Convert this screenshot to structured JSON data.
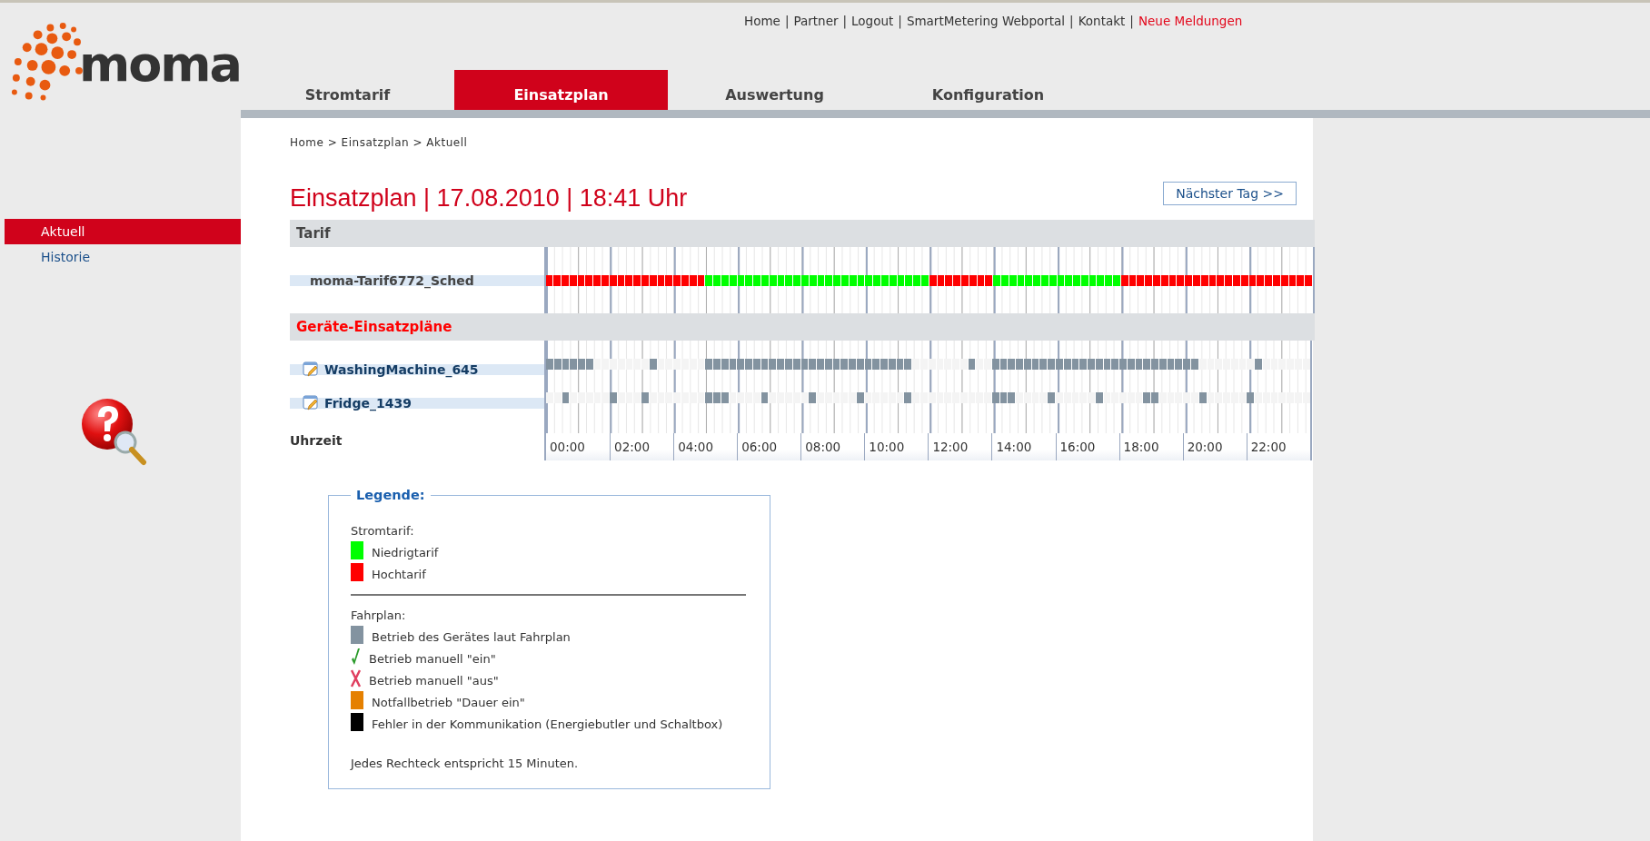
{
  "top_links": {
    "separator": "|",
    "items": [
      {
        "label": "Home",
        "kind": "normal"
      },
      {
        "label": "Partner",
        "kind": "normal"
      },
      {
        "label": "Logout",
        "kind": "normal"
      },
      {
        "label": "SmartMetering Webportal",
        "kind": "normal"
      },
      {
        "label": "Kontakt",
        "kind": "normal"
      },
      {
        "label": "Neue Meldungen",
        "kind": "alert"
      }
    ]
  },
  "logo": {
    "text": "moma"
  },
  "tabs": [
    {
      "label": "Stromtarif",
      "selected": false
    },
    {
      "label": "Einsatzplan",
      "selected": true
    },
    {
      "label": "Auswertung",
      "selected": false
    },
    {
      "label": "Konfiguration",
      "selected": false
    }
  ],
  "sidebar": {
    "items": [
      {
        "label": "Aktuell",
        "selected": true
      },
      {
        "label": "Historie",
        "selected": false
      }
    ]
  },
  "breadcrumb": "Home > Einsatzplan > Aktuell",
  "title": "Einsatzplan | 17.08.2010 | 18:41 Uhr",
  "next_day_button": "Nächster Tag >>",
  "tariff": {
    "heading": "Tarif",
    "name": "moma-Tarif6772_Sched",
    "slots": [
      {
        "low": false
      },
      {
        "low": false
      },
      {
        "low": false
      },
      {
        "low": false
      },
      {
        "low": false
      },
      {
        "low": false
      },
      {
        "low": false
      },
      {
        "low": false
      },
      {
        "low": false
      },
      {
        "low": false
      },
      {
        "low": false
      },
      {
        "low": false
      },
      {
        "low": false
      },
      {
        "low": false
      },
      {
        "low": false
      },
      {
        "low": false
      },
      {
        "low": false
      },
      {
        "low": false
      },
      {
        "low": false
      },
      {
        "low": false
      },
      {
        "low": true
      },
      {
        "low": true
      },
      {
        "low": true
      },
      {
        "low": true
      },
      {
        "low": true
      },
      {
        "low": true
      },
      {
        "low": true
      },
      {
        "low": true
      },
      {
        "low": true
      },
      {
        "low": true
      },
      {
        "low": true
      },
      {
        "low": true
      },
      {
        "low": true
      },
      {
        "low": true
      },
      {
        "low": true
      },
      {
        "low": true
      },
      {
        "low": true
      },
      {
        "low": true
      },
      {
        "low": true
      },
      {
        "low": true
      },
      {
        "low": true
      },
      {
        "low": true
      },
      {
        "low": true
      },
      {
        "low": true
      },
      {
        "low": true
      },
      {
        "low": true
      },
      {
        "low": true
      },
      {
        "low": true
      },
      {
        "low": false
      },
      {
        "low": false
      },
      {
        "low": false
      },
      {
        "low": false
      },
      {
        "low": false
      },
      {
        "low": false
      },
      {
        "low": false
      },
      {
        "low": false
      },
      {
        "low": true
      },
      {
        "low": true
      },
      {
        "low": true
      },
      {
        "low": true
      },
      {
        "low": true
      },
      {
        "low": true
      },
      {
        "low": true
      },
      {
        "low": true
      },
      {
        "low": true
      },
      {
        "low": true
      },
      {
        "low": true
      },
      {
        "low": true
      },
      {
        "low": true
      },
      {
        "low": true
      },
      {
        "low": true
      },
      {
        "low": true
      },
      {
        "low": false
      },
      {
        "low": false
      },
      {
        "low": false
      },
      {
        "low": false
      },
      {
        "low": false
      },
      {
        "low": false
      },
      {
        "low": false
      },
      {
        "low": false
      },
      {
        "low": false
      },
      {
        "low": false
      },
      {
        "low": false
      },
      {
        "low": false
      },
      {
        "low": false
      },
      {
        "low": false
      },
      {
        "low": false
      },
      {
        "low": false
      },
      {
        "low": false
      },
      {
        "low": false
      },
      {
        "low": false
      },
      {
        "low": false
      },
      {
        "low": false
      },
      {
        "low": false
      },
      {
        "low": false
      },
      {
        "low": false
      }
    ]
  },
  "devices": {
    "heading": "Geräte-Einsatzpläne",
    "rows": [
      {
        "name": "WashingMachine_645",
        "slots": [
          {
            "on": true
          },
          {
            "on": true
          },
          {
            "on": true
          },
          {
            "on": true
          },
          {
            "on": true
          },
          {
            "on": true
          },
          {
            "on": false
          },
          {
            "on": false
          },
          {
            "on": false
          },
          {
            "on": false
          },
          {
            "on": false
          },
          {
            "on": false
          },
          {
            "on": false
          },
          {
            "on": true
          },
          {
            "on": false
          },
          {
            "on": false
          },
          {
            "on": false
          },
          {
            "on": false
          },
          {
            "on": false
          },
          {
            "on": false
          },
          {
            "on": true
          },
          {
            "on": true
          },
          {
            "on": true
          },
          {
            "on": true
          },
          {
            "on": true
          },
          {
            "on": true
          },
          {
            "on": true
          },
          {
            "on": true
          },
          {
            "on": true
          },
          {
            "on": true
          },
          {
            "on": true
          },
          {
            "on": true
          },
          {
            "on": true
          },
          {
            "on": true
          },
          {
            "on": true
          },
          {
            "on": true
          },
          {
            "on": true
          },
          {
            "on": true
          },
          {
            "on": true
          },
          {
            "on": true
          },
          {
            "on": true
          },
          {
            "on": true
          },
          {
            "on": true
          },
          {
            "on": true
          },
          {
            "on": true
          },
          {
            "on": true
          },
          {
            "on": false
          },
          {
            "on": false
          },
          {
            "on": false
          },
          {
            "on": false
          },
          {
            "on": false
          },
          {
            "on": false
          },
          {
            "on": false
          },
          {
            "on": true
          },
          {
            "on": false
          },
          {
            "on": false
          },
          {
            "on": true
          },
          {
            "on": true
          },
          {
            "on": true
          },
          {
            "on": true
          },
          {
            "on": true
          },
          {
            "on": true
          },
          {
            "on": true
          },
          {
            "on": true
          },
          {
            "on": true
          },
          {
            "on": true
          },
          {
            "on": true
          },
          {
            "on": true
          },
          {
            "on": true
          },
          {
            "on": true
          },
          {
            "on": true
          },
          {
            "on": true
          },
          {
            "on": true
          },
          {
            "on": true
          },
          {
            "on": true
          },
          {
            "on": true
          },
          {
            "on": true
          },
          {
            "on": true
          },
          {
            "on": true
          },
          {
            "on": true
          },
          {
            "on": true
          },
          {
            "on": true
          },
          {
            "on": false
          },
          {
            "on": false
          },
          {
            "on": false
          },
          {
            "on": false
          },
          {
            "on": false
          },
          {
            "on": false
          },
          {
            "on": false
          },
          {
            "on": true
          },
          {
            "on": false
          },
          {
            "on": false
          },
          {
            "on": false
          },
          {
            "on": false
          },
          {
            "on": false
          },
          {
            "on": false
          }
        ]
      },
      {
        "name": "Fridge_1439",
        "slots": [
          {
            "on": false
          },
          {
            "on": false
          },
          {
            "on": true
          },
          {
            "on": false
          },
          {
            "on": false
          },
          {
            "on": false
          },
          {
            "on": false
          },
          {
            "on": false
          },
          {
            "on": true
          },
          {
            "on": false
          },
          {
            "on": false
          },
          {
            "on": false
          },
          {
            "on": true
          },
          {
            "on": false
          },
          {
            "on": false
          },
          {
            "on": false
          },
          {
            "on": false
          },
          {
            "on": false
          },
          {
            "on": false
          },
          {
            "on": false
          },
          {
            "on": true
          },
          {
            "on": true
          },
          {
            "on": true
          },
          {
            "on": false
          },
          {
            "on": false
          },
          {
            "on": false
          },
          {
            "on": false
          },
          {
            "on": true
          },
          {
            "on": false
          },
          {
            "on": false
          },
          {
            "on": false
          },
          {
            "on": false
          },
          {
            "on": false
          },
          {
            "on": true
          },
          {
            "on": false
          },
          {
            "on": false
          },
          {
            "on": false
          },
          {
            "on": false
          },
          {
            "on": false
          },
          {
            "on": true
          },
          {
            "on": false
          },
          {
            "on": false
          },
          {
            "on": false
          },
          {
            "on": false
          },
          {
            "on": false
          },
          {
            "on": true
          },
          {
            "on": false
          },
          {
            "on": false
          },
          {
            "on": false
          },
          {
            "on": false
          },
          {
            "on": false
          },
          {
            "on": false
          },
          {
            "on": false
          },
          {
            "on": false
          },
          {
            "on": false
          },
          {
            "on": false
          },
          {
            "on": true
          },
          {
            "on": true
          },
          {
            "on": true
          },
          {
            "on": false
          },
          {
            "on": false
          },
          {
            "on": false
          },
          {
            "on": false
          },
          {
            "on": true
          },
          {
            "on": false
          },
          {
            "on": false
          },
          {
            "on": false
          },
          {
            "on": false
          },
          {
            "on": false
          },
          {
            "on": true
          },
          {
            "on": false
          },
          {
            "on": false
          },
          {
            "on": false
          },
          {
            "on": false
          },
          {
            "on": false
          },
          {
            "on": true
          },
          {
            "on": true
          },
          {
            "on": false
          },
          {
            "on": false
          },
          {
            "on": false
          },
          {
            "on": false
          },
          {
            "on": false
          },
          {
            "on": true
          },
          {
            "on": false
          },
          {
            "on": false
          },
          {
            "on": false
          },
          {
            "on": false
          },
          {
            "on": false
          },
          {
            "on": true
          },
          {
            "on": false
          },
          {
            "on": false
          },
          {
            "on": false
          },
          {
            "on": false
          },
          {
            "on": false
          },
          {
            "on": false
          },
          {
            "on": false
          }
        ]
      }
    ]
  },
  "time_axis": {
    "label": "Uhrzeit",
    "ticks": [
      "00:00",
      "02:00",
      "04:00",
      "06:00",
      "08:00",
      "10:00",
      "12:00",
      "14:00",
      "16:00",
      "18:00",
      "20:00",
      "22:00"
    ]
  },
  "legend": {
    "title": "Legende:",
    "sections": [
      {
        "heading": "Stromtarif:",
        "items": [
          {
            "kind": "low",
            "label": "Niedrigtarif"
          },
          {
            "kind": "high",
            "label": "Hochtarif"
          }
        ]
      },
      {
        "heading": "Fahrplan:",
        "items": [
          {
            "kind": "scheduled",
            "label": "Betrieb des Gerätes laut Fahrplan"
          },
          {
            "kind": "manual_on",
            "label": "Betrieb manuell \"ein\""
          },
          {
            "kind": "manual_off",
            "label": "Betrieb manuell \"aus\""
          },
          {
            "kind": "emergency",
            "label": "Notfallbetrieb \"Dauer ein\""
          },
          {
            "kind": "error",
            "label": "Fehler in der Kommunikation (Energiebutler und Schaltbox)"
          }
        ]
      }
    ],
    "note": "Jedes Rechteck entspricht 15 Minuten."
  }
}
